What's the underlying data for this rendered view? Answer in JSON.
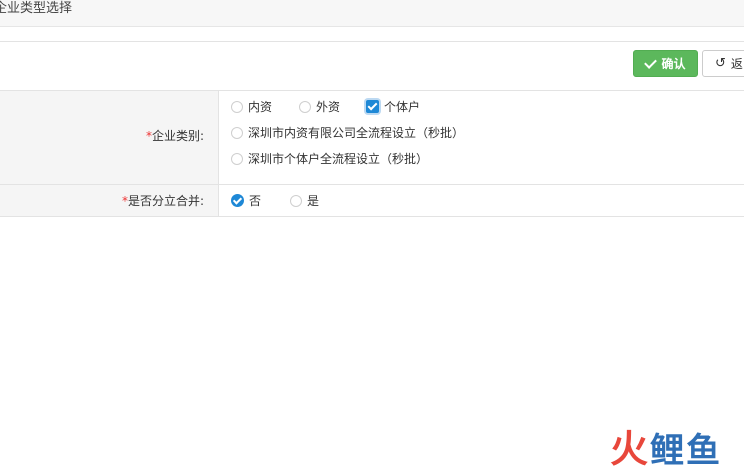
{
  "header": {
    "title": "企业类型选择"
  },
  "toolbar": {
    "confirm_label": "确认",
    "back_label": "返"
  },
  "form": {
    "company_type": {
      "label": "企业类别:",
      "required_mark": "*",
      "options": [
        {
          "label": "内资",
          "selected": false
        },
        {
          "label": "外资",
          "selected": false
        },
        {
          "label": "个体户",
          "selected": true
        },
        {
          "label": "深圳市内资有限公司全流程设立（秒批）",
          "selected": false
        },
        {
          "label": "深圳市个体户全流程设立（秒批）",
          "selected": false
        }
      ]
    },
    "merge": {
      "label": "是否分立合并:",
      "required_mark": "*",
      "options": [
        {
          "label": "否",
          "selected": true
        },
        {
          "label": "是",
          "selected": false
        }
      ]
    }
  },
  "watermark": {
    "symbol": "火",
    "text": "鲤鱼"
  },
  "colors": {
    "confirm_green": "#5cb85c",
    "checked_blue": "#1e88d6",
    "required_red": "#e33333"
  }
}
